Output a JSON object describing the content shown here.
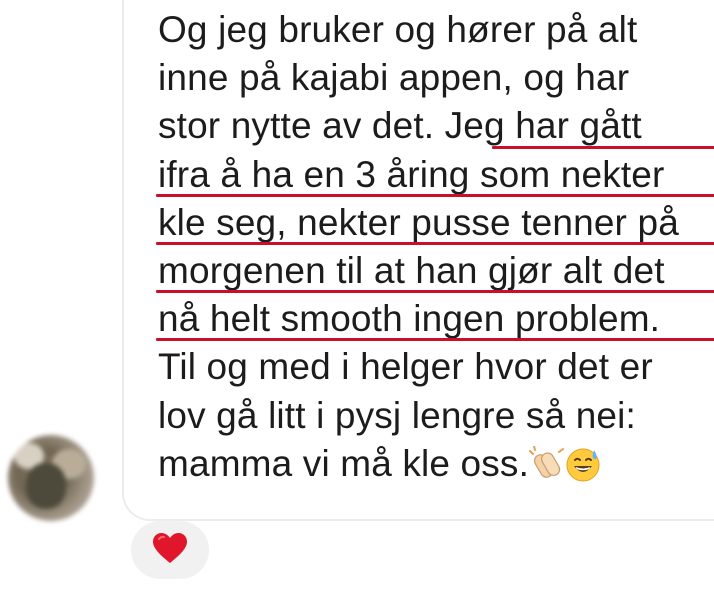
{
  "message": {
    "lines": [
      "Og jeg bruker og hører på alt",
      "inne på kajabi appen, og har",
      "stor nytte av det. Jeg har gått",
      "ifra å ha en 3 åring som nekter",
      "kle seg, nekter pusse tenner på",
      "morgenen til at han gjør alt det",
      "nå helt smooth ingen problem.",
      "Til og med i helger hvor det er",
      "lov gå litt i pysj lengre så nei:",
      "mamma vi må kle oss."
    ],
    "emojis": [
      "clapping-hands",
      "grinning-sweat"
    ],
    "underline_color": "#c8102e"
  },
  "reaction": {
    "emoji": "heart",
    "color": "#e0162b"
  },
  "colors": {
    "text": "#1c1c1c",
    "bubble_border": "#ececec",
    "reaction_bg": "#f1f1f1"
  }
}
